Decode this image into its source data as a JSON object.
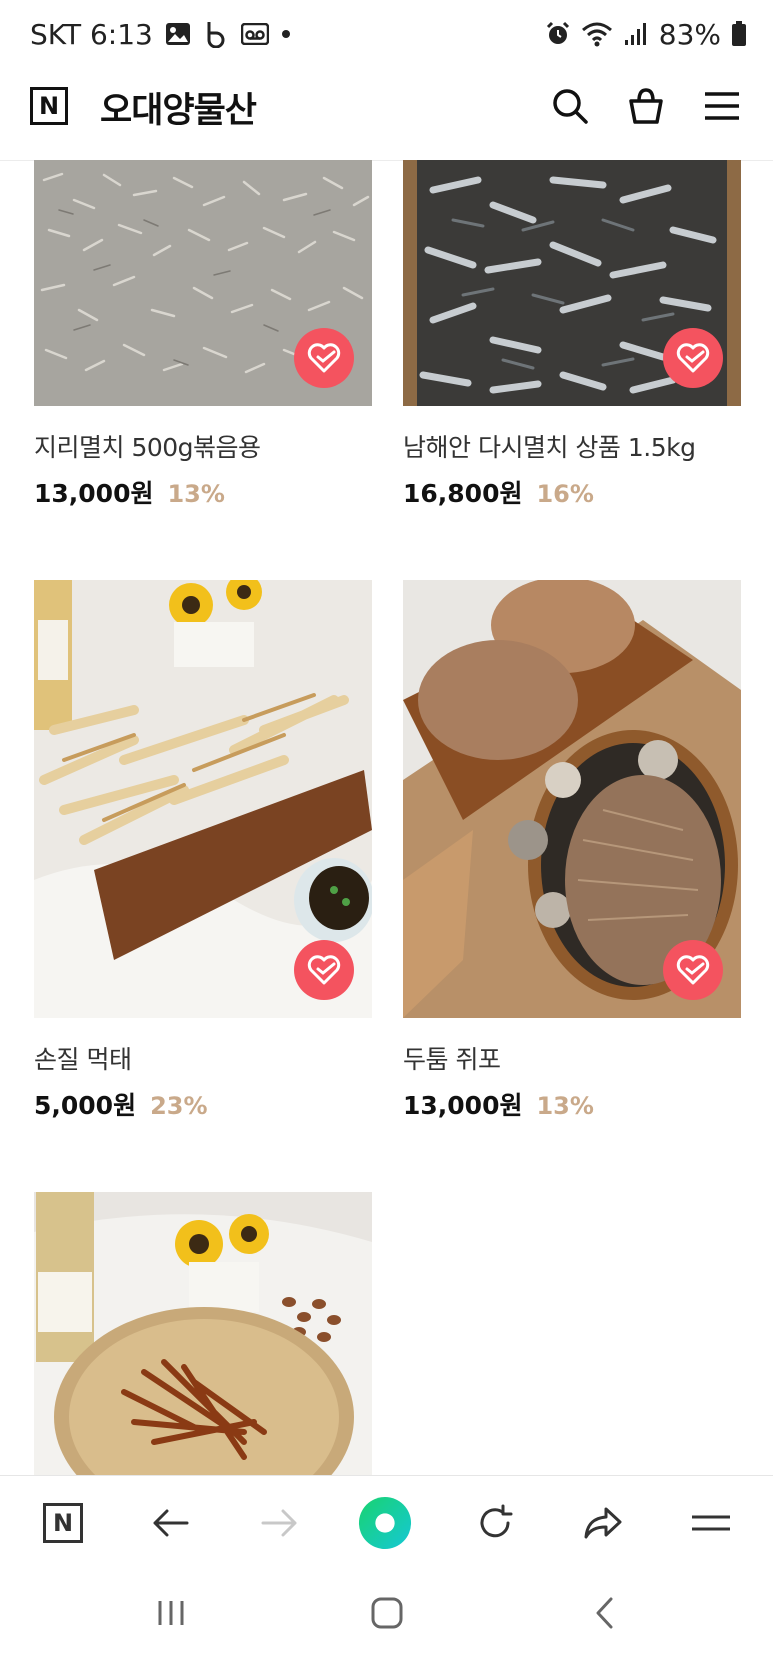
{
  "status_bar": {
    "carrier_time": "SKT 6:13",
    "battery": "83%",
    "icons": [
      "gallery-icon",
      "b-app-icon",
      "voicemail-icon",
      "dot-icon",
      "alarm-icon",
      "wifi-icon",
      "signal-icon",
      "battery-icon"
    ]
  },
  "header": {
    "logo_letter": "N",
    "store_name": "오대양물산",
    "icons": [
      "search-icon",
      "cart-icon",
      "menu-icon"
    ]
  },
  "products": [
    {
      "name": "지리멸치 500g볶음용",
      "price": "13,000원",
      "discount": "13%"
    },
    {
      "name": "남해안 다시멸치 상품 1.5kg",
      "price": "16,800원",
      "discount": "16%"
    },
    {
      "name": "손질 먹태",
      "price": "5,000원",
      "discount": "23%"
    },
    {
      "name": "두툼 쥐포",
      "price": "13,000원",
      "discount": "13%"
    },
    {
      "name": "",
      "price": "",
      "discount": ""
    }
  ],
  "toolbar": {
    "logo_letter": "N",
    "icons": [
      "naver-home-icon",
      "back-arrow-icon",
      "forward-arrow-icon",
      "green-dot-icon",
      "refresh-icon",
      "share-icon",
      "menu-icon"
    ]
  },
  "navbar": {
    "icons": [
      "recent-apps-icon",
      "home-icon",
      "back-icon"
    ]
  },
  "colors": {
    "wish_button": "#f4535f",
    "discount": "#c9a98a",
    "green_dot": "#1fcf8a"
  }
}
